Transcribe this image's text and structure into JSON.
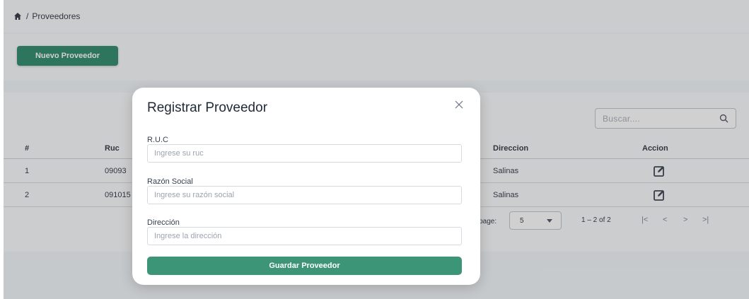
{
  "breadcrumb": {
    "separator": "/",
    "current": "Proveedores"
  },
  "toolbar": {
    "new_button": "Nuevo Proveedor"
  },
  "search": {
    "placeholder": "Buscar...."
  },
  "table": {
    "columns": {
      "num": "#",
      "ruc": "Ruc",
      "direccion": "Direccion",
      "accion": "Accion"
    },
    "rows": [
      {
        "num": "1",
        "ruc": "09093",
        "direccion": "Salinas"
      },
      {
        "num": "2",
        "ruc": "091015",
        "direccion": "Salinas"
      }
    ]
  },
  "pagination": {
    "rows_per_page_label": "r page:",
    "rows_per_page_value": "5",
    "range": "1 – 2 of 2",
    "first": "|<",
    "prev": "<",
    "next": ">",
    "last": ">|"
  },
  "modal": {
    "title": "Registrar Proveedor",
    "fields": [
      {
        "label": "R.U.C",
        "placeholder": "Ingrese su ruc"
      },
      {
        "label": "Razón Social",
        "placeholder": "Ingrese su razón social"
      },
      {
        "label": "Dirección",
        "placeholder": "Ingrese la dirección"
      }
    ],
    "submit": "Guardar Proveedor"
  },
  "colors": {
    "primary": "#0f7a55",
    "submit": "#3d9577"
  }
}
